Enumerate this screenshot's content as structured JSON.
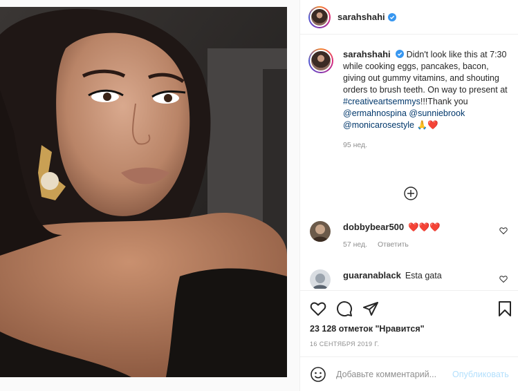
{
  "post": {
    "author": "sarahshahi",
    "caption": {
      "text": "Didn't look like this at 7:30 while cooking eggs, pancakes, bacon, giving out gummy vitamins, and shouting orders to brush teeth. On way to present at",
      "hashtag": "#creativeartsemmys",
      "after_hashtag": "!!!Thank you",
      "mention1": "@ermahnospina",
      "mention2": "@sunniebrook",
      "mention3": "@monicarosestyle",
      "emoji": "🙏❤️",
      "age": "95 нед."
    },
    "comments": [
      {
        "username": "dobbybear500",
        "text": "❤️❤️❤️",
        "age": "57 нед.",
        "reply": "Ответить"
      },
      {
        "username": "guaranablack",
        "text": "Esta gata"
      }
    ],
    "likes": "23 128 отметок \"Нравится\"",
    "date": "16 СЕНТЯБРЯ 2019 Г.",
    "add_comment": {
      "placeholder": "Добавьте комментарий...",
      "publish": "Опубликовать"
    }
  },
  "icons": {
    "verified": "verified-badge-icon",
    "load_more": "plus-circle-icon",
    "like": "heart-icon",
    "comment": "comment-bubble-icon",
    "share": "paper-plane-icon",
    "save": "bookmark-icon",
    "emoji": "smiley-icon"
  },
  "colors": {
    "verified": "#3897f0",
    "link": "#00376b",
    "muted": "#8e8e8e",
    "publish_disabled": "#b2dffc"
  }
}
